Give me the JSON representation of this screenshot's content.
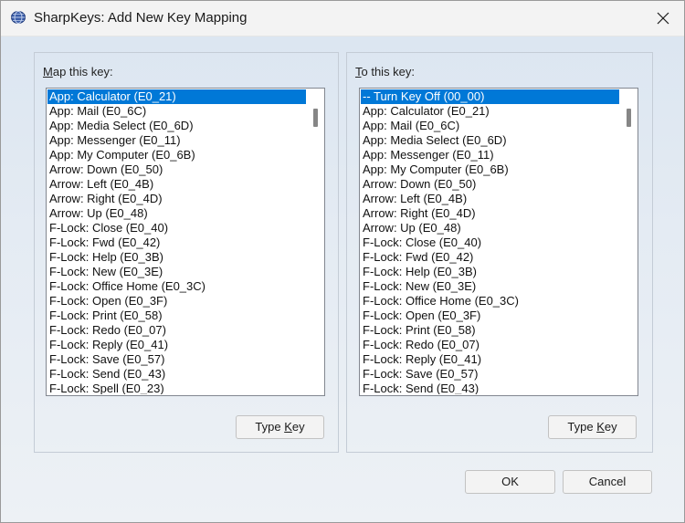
{
  "window": {
    "title": "SharpKeys: Add New Key Mapping",
    "icon": "sharpkeys-app-icon",
    "close_icon": "close-icon"
  },
  "map_group": {
    "label_prefix": "M",
    "label_rest": "ap this key:",
    "items": [
      "App: Calculator (E0_21)",
      "App: Mail (E0_6C)",
      "App: Media Select (E0_6D)",
      "App: Messenger (E0_11)",
      "App: My Computer (E0_6B)",
      "Arrow: Down (E0_50)",
      "Arrow: Left (E0_4B)",
      "Arrow: Right (E0_4D)",
      "Arrow: Up (E0_48)",
      "F-Lock: Close (E0_40)",
      "F-Lock: Fwd (E0_42)",
      "F-Lock: Help (E0_3B)",
      "F-Lock: New (E0_3E)",
      "F-Lock: Office Home (E0_3C)",
      "F-Lock: Open (E0_3F)",
      "F-Lock: Print (E0_58)",
      "F-Lock: Redo (E0_07)",
      "F-Lock: Reply (E0_41)",
      "F-Lock: Save (E0_57)",
      "F-Lock: Send (E0_43)",
      "F-Lock: Spell (E0_23)"
    ],
    "selected_index": 0,
    "type_key_prefix": "Type ",
    "type_key_access": "K",
    "type_key_rest": "ey"
  },
  "to_group": {
    "label_prefix": "T",
    "label_rest": "o this key:",
    "items": [
      "-- Turn Key Off (00_00)",
      "App: Calculator (E0_21)",
      "App: Mail (E0_6C)",
      "App: Media Select (E0_6D)",
      "App: Messenger (E0_11)",
      "App: My Computer (E0_6B)",
      "Arrow: Down (E0_50)",
      "Arrow: Left (E0_4B)",
      "Arrow: Right (E0_4D)",
      "Arrow: Up (E0_48)",
      "F-Lock: Close (E0_40)",
      "F-Lock: Fwd (E0_42)",
      "F-Lock: Help (E0_3B)",
      "F-Lock: New (E0_3E)",
      "F-Lock: Office Home (E0_3C)",
      "F-Lock: Open (E0_3F)",
      "F-Lock: Print (E0_58)",
      "F-Lock: Redo (E0_07)",
      "F-Lock: Reply (E0_41)",
      "F-Lock: Save (E0_57)",
      "F-Lock: Send (E0_43)"
    ],
    "selected_index": 0,
    "type_key_prefix": "Type ",
    "type_key_access": "K",
    "type_key_rest": "ey"
  },
  "buttons": {
    "ok": "OK",
    "cancel": "Cancel"
  },
  "colors": {
    "selection": "#0078d7",
    "dialog_background": "#dfe8f2"
  }
}
